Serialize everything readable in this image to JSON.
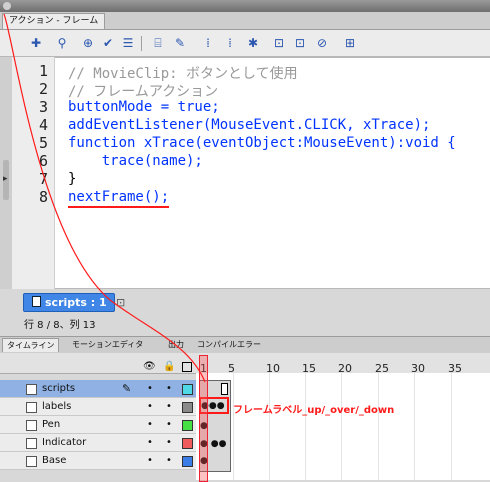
{
  "panel": {
    "title": "アクション - フレーム"
  },
  "toolbar": {
    "icons": [
      "add-icon",
      "find-icon",
      "target-icon",
      "check-icon",
      "autoformat-icon",
      "code-hint-icon",
      "debug-icon",
      "collapse-icon",
      "collapse-selection-icon",
      "expand-icon",
      "comment-block-icon",
      "comment-line-icon",
      "uncomment-icon",
      "show-toolbox-icon"
    ]
  },
  "editor": {
    "line_numbers": [
      "1",
      "2",
      "3",
      "4",
      "5",
      "6",
      "7",
      "8"
    ],
    "lines": [
      "// MovieClip: ボタンとして使用",
      "// フレームアクション",
      "buttonMode = true;",
      "addEventListener(MouseEvent.CLICK, xTrace);",
      "function xTrace(eventObject:MouseEvent):void {",
      "    trace(name);",
      "}",
      "nextFrame();"
    ]
  },
  "script_tab": {
    "label": "scripts : 1"
  },
  "status": {
    "text": "行 8 / 8、列 13"
  },
  "timeline_tabs": [
    "タイムライン",
    "モーションエディタ",
    "出力",
    "コンパイルエラー"
  ],
  "timeline": {
    "ticks": [
      "1",
      "5",
      "10",
      "15",
      "20",
      "25",
      "30",
      "35"
    ],
    "layers": [
      {
        "name": "scripts",
        "color": "#4fd9e6",
        "selected": true
      },
      {
        "name": "labels",
        "color": "#8a8a8a",
        "selected": false
      },
      {
        "name": "Pen",
        "color": "#44e044",
        "selected": false
      },
      {
        "name": "Indicator",
        "color": "#f05a5a",
        "selected": false
      },
      {
        "name": "Base",
        "color": "#3a7de6",
        "selected": false
      }
    ],
    "annotation": "フレームラベル_up/_over/_down"
  },
  "colors": {
    "annotation": "#ff1a1a",
    "keyword": "#0033ff",
    "comment": "#999999"
  }
}
